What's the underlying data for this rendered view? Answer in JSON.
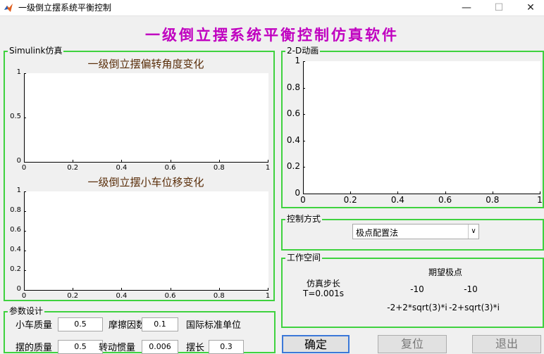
{
  "window": {
    "title": "一级倒立摆系统平衡控制",
    "minimize": "—",
    "maximize": "☐",
    "close": "✕"
  },
  "header": {
    "title": "一级倒立摆系统平衡控制仿真软件"
  },
  "simulink_panel": {
    "label": "Simulink仿真",
    "axes1": {
      "title": "一级倒立摆偏转角度变化",
      "yticks": [
        "0",
        "0.5",
        "1"
      ],
      "xticks": [
        "0",
        "0.2",
        "0.4",
        "0.6",
        "0.8",
        "1"
      ]
    },
    "axes2": {
      "title": "一级倒立摆小车位移变化",
      "yticks": [
        "0",
        "0.2",
        "0.4",
        "0.6",
        "0.8",
        "1"
      ],
      "xticks": [
        "0",
        "0.2",
        "0.4",
        "0.6",
        "0.8",
        "1"
      ]
    }
  },
  "animation_panel": {
    "label": "2-D动画",
    "yticks": [
      "0",
      "0.2",
      "0.4",
      "0.6",
      "0.8",
      "1"
    ],
    "xticks": [
      "0",
      "0.2",
      "0.4",
      "0.6",
      "0.8",
      "1"
    ]
  },
  "control_panel": {
    "label": "控制方式",
    "selected": "极点配置法"
  },
  "workspace_panel": {
    "label": "工作空间",
    "step_label": "仿真步长",
    "step_value": "T=0.001s",
    "poles_title": "期望极点",
    "pole1": "-10",
    "pole2": "-10",
    "pole3": "-2+2*sqrt(3)*i",
    "pole4": "-2+sqrt(3)*i"
  },
  "params_panel": {
    "label": "参数设计",
    "cart_mass_label": "小车质量",
    "cart_mass_value": "0.5",
    "friction_label": "摩擦因数",
    "friction_value": "0.1",
    "units_label": "国际标准单位",
    "row2_label1": "摆的质量",
    "row2_value1": "0.5",
    "row2_label2": "转动惯量",
    "row2_value2": "0.006",
    "row2_label3": "摆长",
    "row2_value3": "0.3"
  },
  "buttons": {
    "confirm": "确定",
    "reset": "复位",
    "exit": "退出"
  }
}
